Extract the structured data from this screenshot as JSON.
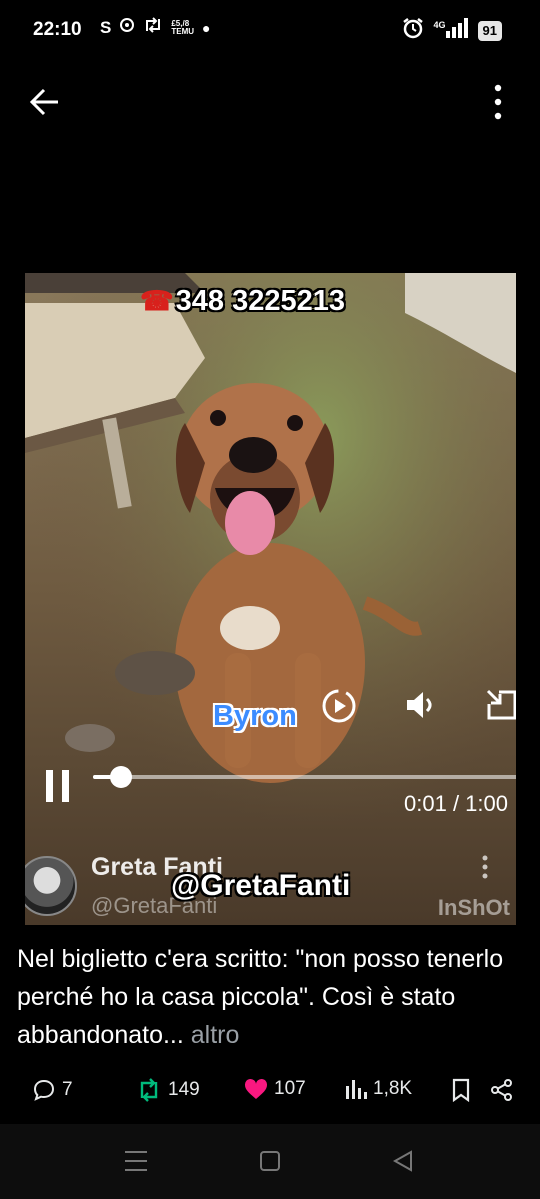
{
  "status_bar": {
    "time": "22:10",
    "app_icons": [
      "S",
      "chat-bubble-icon",
      "retweet-icon"
    ],
    "tiny_text": "£5,/8\nTEMU",
    "network": "4G",
    "battery": "91"
  },
  "video": {
    "phone_number": "348 3225213",
    "dog_name": "Byron",
    "handle_overlay": "@GretaFanti",
    "author_name": "Greta Fanti",
    "author_handle": "@GretaFanti",
    "watermark": "InShOt",
    "time_readout": "0:01 / 1:00",
    "progress_fraction": 0.065
  },
  "caption": {
    "text": "Nel biglietto c'era scritto: \"non posso tenerlo perché ho la casa piccola\". Così è stato abbandonato...",
    "more": " altro"
  },
  "actions": {
    "replies": "7",
    "reposts": "149",
    "likes": "107",
    "views": "1,8K"
  },
  "colors": {
    "repost_green": "#00ba7c",
    "like_pink": "#f91880",
    "battery_bg": "#e6e6e6"
  }
}
